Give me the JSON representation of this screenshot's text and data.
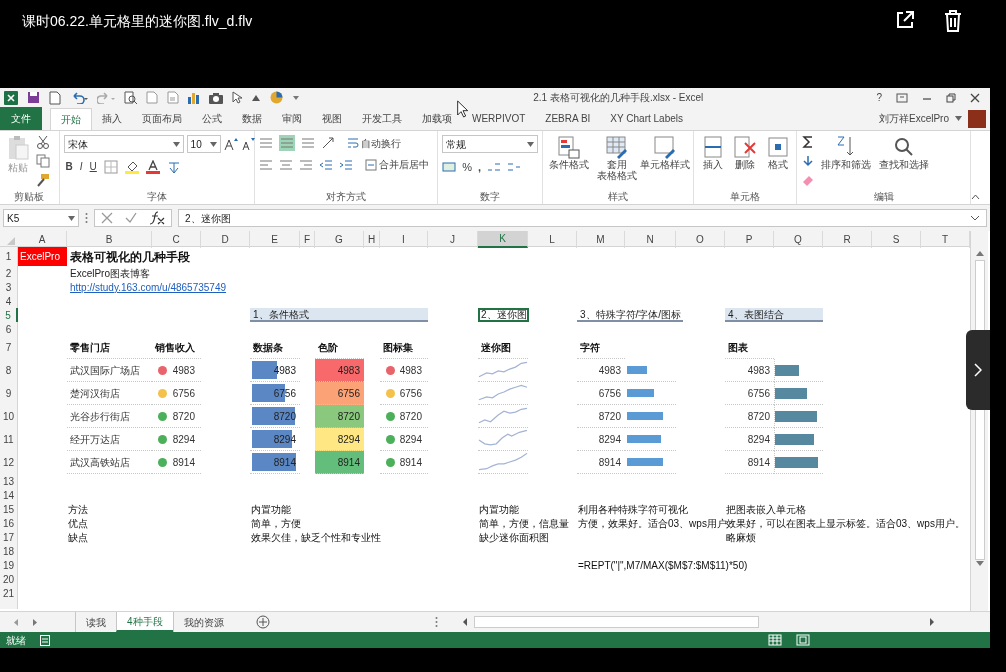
{
  "video": {
    "title": "课时06.22.单元格里的迷你图.flv_d.flv"
  },
  "excel": {
    "title": "2.1 表格可视化的几种手段.xlsx - Excel",
    "help": "?",
    "user": "刘万祥ExcelPro",
    "tabs": [
      {
        "label": "文件",
        "kind": "file",
        "selected": false
      },
      {
        "label": "开始",
        "kind": "tab",
        "selected": true
      },
      {
        "label": "插入",
        "kind": "tab",
        "selected": false
      },
      {
        "label": "页面布局",
        "kind": "tab",
        "selected": false
      },
      {
        "label": "公式",
        "kind": "tab",
        "selected": false
      },
      {
        "label": "数据",
        "kind": "tab",
        "selected": false
      },
      {
        "label": "审阅",
        "kind": "tab",
        "selected": false
      },
      {
        "label": "视图",
        "kind": "tab",
        "selected": false
      },
      {
        "label": "开发工具",
        "kind": "tab",
        "selected": false
      },
      {
        "label": "加载项",
        "kind": "tab",
        "selected": false
      },
      {
        "label": "WERPIVOT",
        "kind": "tab",
        "selected": false
      },
      {
        "label": "ZEBRA BI",
        "kind": "tab",
        "selected": false
      },
      {
        "label": "XY Chart Labels",
        "kind": "tab",
        "selected": false
      }
    ],
    "ribbon": [
      {
        "kind": "clipboard",
        "label": "剪贴板",
        "paste": "粘贴"
      },
      {
        "kind": "font",
        "label": "字体",
        "font": "宋体",
        "size": "10",
        "bold": "B",
        "italic": "I",
        "underline": "U"
      },
      {
        "kind": "alignment",
        "label": "对齐方式",
        "wrap": "自动换行",
        "merge": "合并后居中"
      },
      {
        "kind": "number",
        "label": "数字",
        "format": "常规",
        "percent": "%",
        "comma": ","
      },
      {
        "kind": "styles",
        "label": "样式",
        "buttons": [
          {
            "lines": [
              "条件格式"
            ]
          },
          {
            "lines": [
              "套用",
              "表格格式"
            ]
          },
          {
            "lines": [
              "单元格样式"
            ]
          }
        ]
      },
      {
        "kind": "cells",
        "label": "单元格",
        "buttons": [
          {
            "lines": [
              "插入"
            ]
          },
          {
            "lines": [
              "删除"
            ]
          },
          {
            "lines": [
              "格式"
            ]
          }
        ]
      },
      {
        "kind": "editing",
        "label": "编辑",
        "buttons": [
          {
            "lines": [
              "排序和筛选"
            ]
          },
          {
            "lines": [
              "查找和选择"
            ]
          }
        ]
      }
    ],
    "formula_bar": {
      "name_box": "K5",
      "formula": "2、迷你图"
    },
    "columns": [
      {
        "label": "A",
        "selected": false
      },
      {
        "label": "B",
        "selected": false
      },
      {
        "label": "C",
        "selected": false
      },
      {
        "label": "D",
        "selected": false
      },
      {
        "label": "E",
        "selected": false
      },
      {
        "label": "F",
        "selected": false
      },
      {
        "label": "G",
        "selected": false
      },
      {
        "label": "H",
        "selected": false
      },
      {
        "label": "I",
        "selected": false
      },
      {
        "label": "J",
        "selected": false
      },
      {
        "label": "K",
        "selected": true
      },
      {
        "label": "L",
        "selected": false
      },
      {
        "label": "M",
        "selected": false
      },
      {
        "label": "N",
        "selected": false
      },
      {
        "label": "O",
        "selected": false
      },
      {
        "label": "P",
        "selected": false
      },
      {
        "label": "Q",
        "selected": false
      },
      {
        "label": "R",
        "selected": false
      },
      {
        "label": "S",
        "selected": false
      },
      {
        "label": "T",
        "selected": false
      }
    ],
    "rows": [
      {
        "label": "1",
        "selected": false,
        "cells": {
          "A": {
            "kind": "tag",
            "text": "ExcelPro"
          },
          "B": {
            "kind": "title",
            "text": "表格可视化的几种手段"
          }
        }
      },
      {
        "label": "2",
        "selected": false,
        "cells": {
          "B": {
            "kind": "text",
            "text": "ExcelPro图表博客"
          }
        }
      },
      {
        "label": "3",
        "selected": false,
        "cells": {
          "B": {
            "kind": "link",
            "text": "http://study.163.com/u/4865735749"
          }
        }
      },
      {
        "label": "4",
        "selected": false,
        "cells": {}
      },
      {
        "label": "5",
        "selected": true,
        "cells": {
          "E": {
            "kind": "section",
            "text": "1、条件格式",
            "highlighted": true
          },
          "K": {
            "kind": "section",
            "text": "2、迷你图",
            "highlighted": false
          },
          "M": {
            "kind": "section",
            "text": "3、特殊字符/字体/图标",
            "highlighted": false
          },
          "P": {
            "kind": "section",
            "text": "4、表图结合",
            "highlighted": true
          }
        }
      },
      {
        "label": "6",
        "selected": false,
        "cells": {}
      },
      {
        "label": "7",
        "selected": false,
        "cells": {
          "B": {
            "kind": "header",
            "text": "零售门店"
          },
          "C": {
            "kind": "header",
            "text": "销售收入"
          },
          "E": {
            "kind": "header",
            "text": "数据条"
          },
          "G": {
            "kind": "header",
            "text": "色阶"
          },
          "I": {
            "kind": "header",
            "text": "图标集"
          },
          "K": {
            "kind": "header",
            "text": "迷你图"
          },
          "M": {
            "kind": "header",
            "text": "字符"
          },
          "P": {
            "kind": "header",
            "text": "图表"
          }
        }
      },
      {
        "label": "8",
        "selected": false,
        "cells": {
          "B": {
            "kind": "store",
            "text": "武汉国际广场店"
          },
          "C": {
            "kind": "dot",
            "text": "4983",
            "color": "#e8636a"
          },
          "E": {
            "kind": "databar",
            "text": "4983",
            "level": 0.55
          },
          "G": {
            "kind": "scale",
            "text": "4983",
            "color": "#f8696b"
          },
          "I": {
            "kind": "dot",
            "text": "4983",
            "color": "#e8636a"
          },
          "K": {
            "kind": "sparkline"
          },
          "M": {
            "kind": "number",
            "text": "4983"
          },
          "N": {
            "kind": "charbar",
            "level": 0.41
          },
          "P": {
            "kind": "number",
            "text": "4983"
          },
          "Q": {
            "kind": "chartbar",
            "level": 0.5
          }
        }
      },
      {
        "label": "9",
        "selected": false,
        "cells": {
          "B": {
            "kind": "store",
            "text": "楚河汉街店"
          },
          "C": {
            "kind": "dot",
            "text": "6756",
            "color": "#f4c24b"
          },
          "E": {
            "kind": "databar",
            "text": "6756",
            "level": 0.72
          },
          "G": {
            "kind": "scale",
            "text": "6756",
            "color": "#fba276"
          },
          "I": {
            "kind": "dot",
            "text": "6756",
            "color": "#f4c24b"
          },
          "K": {
            "kind": "sparkline"
          },
          "M": {
            "kind": "number",
            "text": "6756"
          },
          "N": {
            "kind": "charbar",
            "level": 0.56
          },
          "P": {
            "kind": "number",
            "text": "6756"
          },
          "Q": {
            "kind": "chartbar",
            "level": 0.68
          }
        }
      },
      {
        "label": "10",
        "selected": false,
        "cells": {
          "B": {
            "kind": "store",
            "text": "光谷步行街店"
          },
          "C": {
            "kind": "dot",
            "text": "8720",
            "color": "#4caf5a"
          },
          "E": {
            "kind": "databar",
            "text": "8720",
            "level": 0.94
          },
          "G": {
            "kind": "scale",
            "text": "8720",
            "color": "#8ac97d"
          },
          "I": {
            "kind": "dot",
            "text": "8720",
            "color": "#4caf5a"
          },
          "K": {
            "kind": "sparkline"
          },
          "M": {
            "kind": "number",
            "text": "8720"
          },
          "N": {
            "kind": "charbar",
            "level": 0.74
          },
          "P": {
            "kind": "number",
            "text": "8720"
          },
          "Q": {
            "kind": "chartbar",
            "level": 0.9
          }
        }
      },
      {
        "label": "11",
        "selected": false,
        "cells": {
          "B": {
            "kind": "store",
            "text": "经开万达店"
          },
          "C": {
            "kind": "dot",
            "text": "8294",
            "color": "#4caf5a"
          },
          "E": {
            "kind": "databar",
            "text": "8294",
            "level": 0.88
          },
          "G": {
            "kind": "scale",
            "text": "8294",
            "color": "#ffe883"
          },
          "I": {
            "kind": "dot",
            "text": "8294",
            "color": "#4caf5a"
          },
          "K": {
            "kind": "sparkline"
          },
          "M": {
            "kind": "number",
            "text": "8294"
          },
          "N": {
            "kind": "charbar",
            "level": 0.7
          },
          "P": {
            "kind": "number",
            "text": "8294"
          },
          "Q": {
            "kind": "chartbar",
            "level": 0.84
          }
        }
      },
      {
        "label": "12",
        "selected": false,
        "cells": {
          "B": {
            "kind": "store",
            "text": "武汉高铁站店"
          },
          "C": {
            "kind": "dot",
            "text": "8914",
            "color": "#4caf5a"
          },
          "E": {
            "kind": "databar",
            "text": "8914",
            "level": 0.96
          },
          "G": {
            "kind": "scale",
            "text": "8914",
            "color": "#63be7b"
          },
          "I": {
            "kind": "dot",
            "text": "8914",
            "color": "#4caf5a"
          },
          "K": {
            "kind": "sparkline"
          },
          "M": {
            "kind": "number",
            "text": "8914"
          },
          "N": {
            "kind": "charbar",
            "level": 0.76
          },
          "P": {
            "kind": "number",
            "text": "8914"
          },
          "Q": {
            "kind": "chartbar",
            "level": 0.92
          }
        }
      },
      {
        "label": "13",
        "selected": false,
        "cells": {}
      },
      {
        "label": "14",
        "selected": false,
        "cells": {}
      },
      {
        "label": "15",
        "selected": false,
        "cells": {
          "B": {
            "kind": "note",
            "text": "方法"
          },
          "E": {
            "kind": "note",
            "text": "内置功能"
          },
          "K": {
            "kind": "note",
            "text": "内置功能"
          },
          "M": {
            "kind": "note",
            "text": "利用各种特殊字符可视化"
          },
          "P": {
            "kind": "note",
            "text": "把图表嵌入单元格"
          }
        }
      },
      {
        "label": "16",
        "selected": false,
        "cells": {
          "B": {
            "kind": "note",
            "text": "优点"
          },
          "E": {
            "kind": "note",
            "text": "简单，方便"
          },
          "K": {
            "kind": "note",
            "text": "简单，方便，信息量"
          },
          "M": {
            "kind": "note",
            "text": "方便，效果好。适合03、wps用户"
          },
          "P": {
            "kind": "note",
            "text": "效果好，可以在图表上显示标签。适合03、wps用户。"
          }
        }
      },
      {
        "label": "17",
        "selected": false,
        "cells": {
          "B": {
            "kind": "note",
            "text": "缺点"
          },
          "E": {
            "kind": "note",
            "text": "效果欠佳，缺乏个性和专业性"
          },
          "K": {
            "kind": "note",
            "text": "缺少迷你面积图"
          },
          "P": {
            "kind": "note",
            "text": "略麻烦"
          }
        }
      },
      {
        "label": "18",
        "selected": false,
        "cells": {}
      },
      {
        "label": "19",
        "selected": false,
        "cells": {
          "M": {
            "kind": "formula",
            "text": "=REPT(\"|\",M7/MAX($M$7:$M$11)*50)"
          }
        }
      },
      {
        "label": "20",
        "selected": false,
        "cells": {}
      },
      {
        "label": "21",
        "selected": false,
        "cells": {}
      }
    ],
    "sheet_tabs": [
      {
        "label": "读我",
        "selected": false
      },
      {
        "label": "4种手段",
        "selected": true
      },
      {
        "label": "我的资源",
        "selected": false
      }
    ],
    "status": "就绪"
  }
}
